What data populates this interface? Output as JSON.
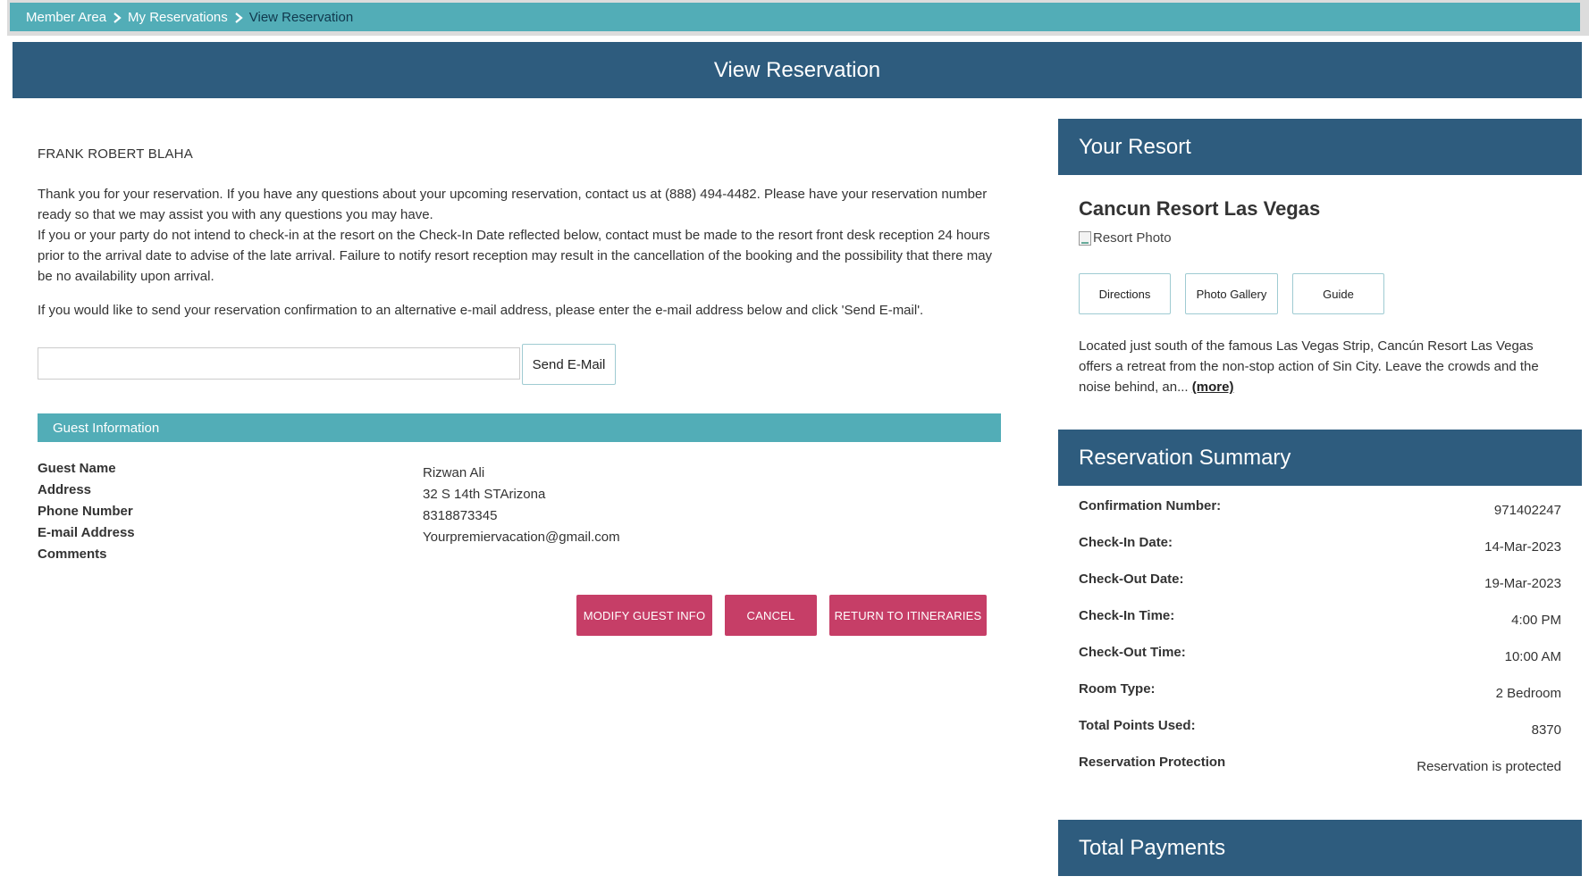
{
  "breadcrumb": {
    "items": [
      "Member Area",
      "My Reservations",
      "View Reservation"
    ]
  },
  "page_title": "View Reservation",
  "guest_display_name": "FRANK ROBERT BLAHA",
  "paragraphs": {
    "p1": "Thank you for your reservation. If you have any questions about your upcoming reservation, contact us at (888) 494-4482. Please have your reservation number ready so that we may assist you with any questions you may have.",
    "p2": "If you or your party do not intend to check-in at the resort on the Check-In Date reflected below, contact must be made to the resort front desk reception 24 hours prior to the arrival date to advise of the late arrival. Failure to notify resort reception may result in the cancellation of the booking and the possibility that there may be no availability upon arrival.",
    "p3": "If you would like to send your reservation confirmation to an alternative e-mail address, please enter the e-mail address below and click 'Send E-mail'."
  },
  "email_form": {
    "value": "",
    "send_label": "Send E-Mail"
  },
  "guest_info": {
    "header": "Guest Information",
    "labels": [
      "Guest Name",
      "Address",
      "Phone Number",
      "E-mail Address",
      "Comments"
    ],
    "values": [
      "Rizwan  Ali",
      "32 S 14th STArizona",
      "8318873345",
      "Yourpremiervacation@gmail.com",
      ""
    ]
  },
  "actions": {
    "modify": "MODIFY GUEST INFO",
    "cancel": "CANCEL",
    "return": "RETURN TO ITINERARIES"
  },
  "resort": {
    "panel_title": "Your Resort",
    "name": "Cancun Resort Las Vegas",
    "photo_alt": "Resort Photo",
    "buttons": [
      "Directions",
      "Photo Gallery",
      "Guide"
    ],
    "description": "Located just south of the famous Las Vegas Strip, Cancún Resort Las Vegas offers a retreat from the non-stop action of Sin City. Leave the crowds and the noise behind, an...",
    "more_label": "(more)"
  },
  "summary": {
    "panel_title": "Reservation Summary",
    "rows": [
      {
        "label": "Confirmation Number:",
        "value": "971402247"
      },
      {
        "label": "Check-In Date:",
        "value": "14-Mar-2023"
      },
      {
        "label": "Check-Out Date:",
        "value": "19-Mar-2023"
      },
      {
        "label": "Check-In Time:",
        "value": "4:00 PM"
      },
      {
        "label": "Check-Out Time:",
        "value": "10:00 AM"
      },
      {
        "label": "Room Type:",
        "value": "2 Bedroom"
      },
      {
        "label": "Total Points Used:",
        "value": "8370"
      },
      {
        "label": "Reservation Protection",
        "value": "Reservation is protected"
      }
    ]
  },
  "payments": {
    "panel_title": "Total Payments"
  },
  "colors": {
    "teal": "#52adb7",
    "navy": "#2e5c7e",
    "action_pink": "#c63e67"
  }
}
